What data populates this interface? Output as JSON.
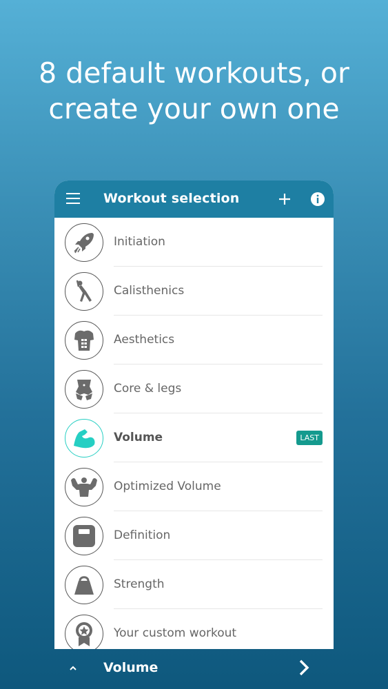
{
  "headline": {
    "line1": "8 default workouts, or",
    "line2": "create your own one"
  },
  "appbar": {
    "title": "Workout selection",
    "icons": [
      "menu-icon",
      "add-icon",
      "info-icon"
    ]
  },
  "workouts": [
    {
      "label": "Initiation",
      "icon": "rocket-icon"
    },
    {
      "label": "Calisthenics",
      "icon": "stretch-icon"
    },
    {
      "label": "Aesthetics",
      "icon": "torso-icon"
    },
    {
      "label": "Core & legs",
      "icon": "core-icon"
    },
    {
      "label": "Volume",
      "icon": "bicep-icon",
      "badge": "LAST"
    },
    {
      "label": "Optimized Volume",
      "icon": "bodybuilder-icon"
    },
    {
      "label": "Definition",
      "icon": "scale-icon"
    },
    {
      "label": "Strength",
      "icon": "kettlebell-icon"
    },
    {
      "label": "Your custom workout",
      "icon": "medal-icon"
    }
  ],
  "bottom": {
    "selected": "Volume"
  },
  "colors": {
    "appbar": "#1e7fa3",
    "accent": "#26cfc3",
    "badge": "#149a8e",
    "icon": "#6b6b6b"
  }
}
